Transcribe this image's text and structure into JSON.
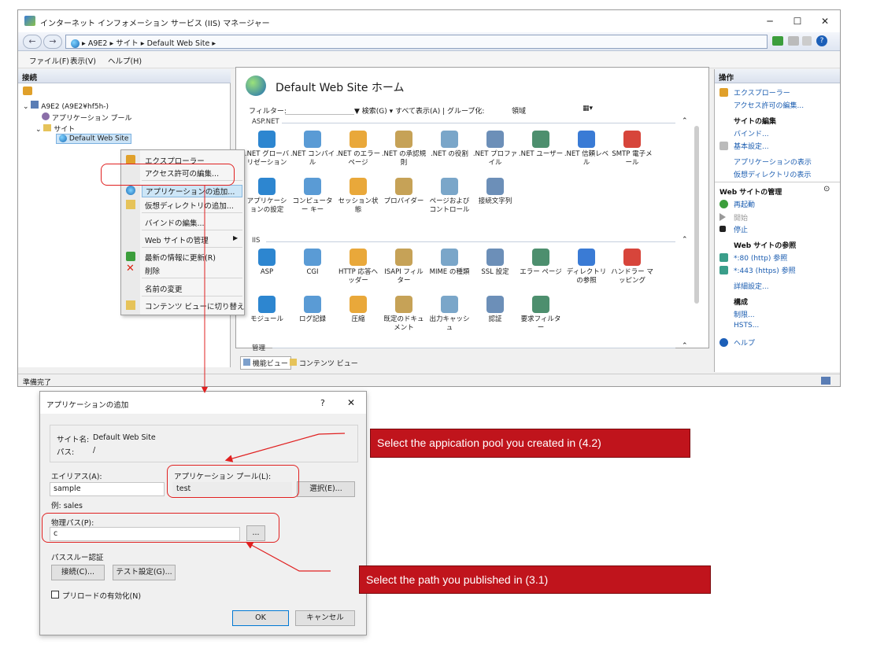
{
  "window": {
    "title": "インターネット インフォメーション サービス (IIS) マネージャー",
    "address": [
      "A9E2",
      "サイト",
      "Default Web Site"
    ],
    "menu": [
      "ファイル(F)",
      "表示(V)",
      "ヘルプ(H)"
    ],
    "status": "準備完了"
  },
  "connections": {
    "header": "接続",
    "tree": {
      "server": "A9E2 (A9E2¥hf5h-)",
      "app_pools": "アプリケーション プール",
      "sites": "サイト",
      "site": "Default Web Site"
    }
  },
  "context_menu": [
    "エクスプローラー",
    "アクセス許可の編集...",
    "アプリケーションの追加...",
    "仮想ディレクトリの追加...",
    "バインドの編集...",
    "Web サイトの管理",
    "最新の情報に更新(R)",
    "削除",
    "名前の変更",
    "コンテンツ ビューに切り替え"
  ],
  "center": {
    "title": "Default Web Site ホーム",
    "filter_label": "フィルター:",
    "filter_actions": "▼ 検索(G) ▾ すべて表示(A) | グループ化:",
    "group_value": "領域",
    "sections": {
      "aspnet": "ASP.NET",
      "iis": "IIS",
      "management": "管理"
    },
    "aspnet_features": [
      ".NET グローバリゼーション",
      ".NET コンパイル",
      ".NET のエラー ページ",
      ".NET の承認規則",
      ".NET の役割",
      ".NET プロファイル",
      ".NET ユーザー",
      ".NET 信頼レベル",
      "SMTP 電子メール",
      "アプリケーションの設定",
      "コンピューター キー",
      "セッション状態",
      "プロバイダー",
      "ページおよびコントロール",
      "接続文字列"
    ],
    "iis_features": [
      "ASP",
      "CGI",
      "HTTP 応答ヘッダー",
      "ISAPI フィルター",
      "MIME の種類",
      "SSL 設定",
      "エラー ページ",
      "ディレクトリの参照",
      "ハンドラー マッピング",
      "モジュール",
      "ログ記録",
      "圧縮",
      "既定のドキュメント",
      "出力キャッシュ",
      "認証",
      "要求フィルター"
    ],
    "tabs": [
      "機能ビュー",
      "コンテンツ ビュー"
    ]
  },
  "actions": {
    "header": "操作",
    "items": {
      "explorer": "エクスプローラー",
      "perm": "アクセス許可の編集...",
      "edit_site": "サイトの編集",
      "bind": "バインド...",
      "basic": "基本設定...",
      "apps": "アプリケーションの表示",
      "vdirs": "仮想ディレクトリの表示",
      "manage": "Web サイトの管理",
      "restart": "再起動",
      "start": "開始",
      "stop": "停止",
      "browse": "Web サイトの参照",
      "http": "*:80 (http) 参照",
      "https": "*:443 (https) 参照",
      "advanced": "詳細設定...",
      "config": "構成",
      "limits": "制限...",
      "hsts": "HSTS...",
      "help": "ヘルプ"
    }
  },
  "dialog": {
    "title": "アプリケーションの追加",
    "help": "?",
    "close": "✕",
    "site_label": "サイト名:",
    "site_value": "Default Web Site",
    "path_label": "パス:",
    "path_value": "/",
    "alias_label": "エイリアス(A):",
    "alias_value": "sample",
    "alias_example": "例: sales",
    "pool_label": "アプリケーション プール(L):",
    "pool_value": "test",
    "select_button": "選択(E)...",
    "physical_label": "物理パス(P):",
    "physical_value": "c",
    "browse_button": "...",
    "passthrough_label": "パススルー認証",
    "connect_button": "接続(C)...",
    "test_button": "テスト設定(G)...",
    "preload_label": "プリロードの有効化(N)",
    "ok": "OK",
    "cancel": "キャンセル"
  },
  "callouts": {
    "pool": "Select the appication pool you created in (4.2)",
    "path": "Select the path you published in (3.1)"
  }
}
